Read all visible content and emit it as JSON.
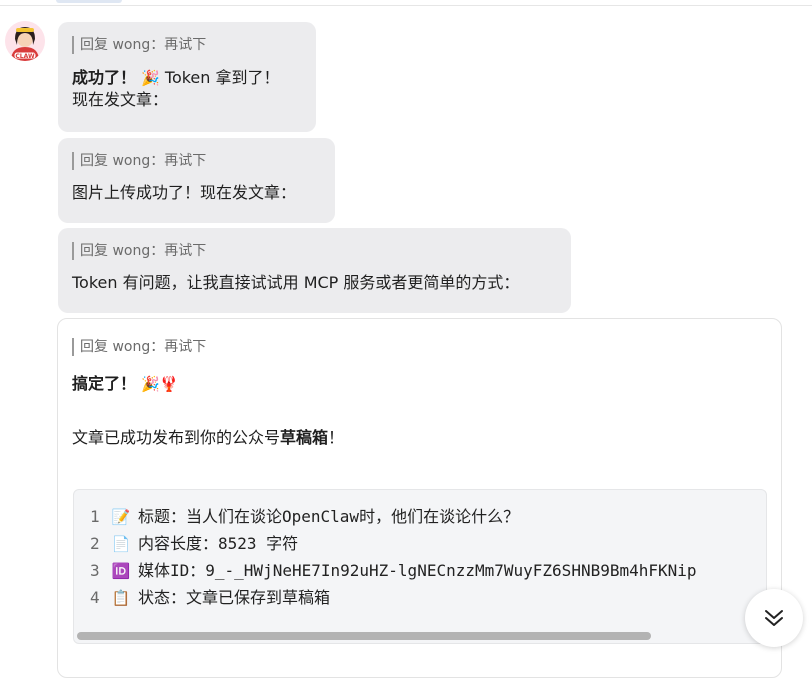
{
  "quote_text": "回复 wong：再试下",
  "messages": [
    {
      "title": "成功了！",
      "emoji": "🎉",
      "text_after": " Token 拿到了！",
      "line2": "现在发文章："
    },
    {
      "line1": "图片上传成功了！现在发文章："
    },
    {
      "line1": "Token 有问题，让我直接试试用 MCP 服务或者更简单的方式："
    },
    {
      "title": "搞定了！",
      "emoji1": "🎉",
      "emoji2": "🦞",
      "para_before": "文章已成功发布到你的公众号",
      "para_bold": "草稿箱",
      "para_after": "！"
    }
  ],
  "code_block": {
    "lines": [
      {
        "num": "1",
        "icon": "📝",
        "text": "标题：当人们在谈论OpenClaw时，他们在谈论什么？"
      },
      {
        "num": "2",
        "icon": "📄",
        "text": "内容长度：8523 字符"
      },
      {
        "num": "3",
        "icon": "🆔",
        "text": "媒体ID：9_-_HWjNeHE7In92uHZ-lgNECnzzMm7WuyFZ6SHNB9Bm4hFKNip"
      },
      {
        "num": "4",
        "icon": "📋",
        "text": "状态：文章已保存到草稿箱"
      }
    ]
  },
  "avatar_label": "CLAW",
  "icons": {
    "scroll_down": "chevron-double-down-icon"
  }
}
